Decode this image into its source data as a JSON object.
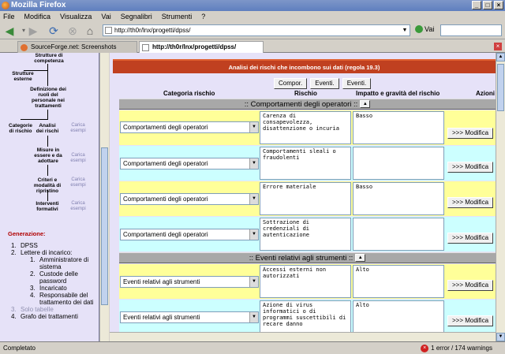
{
  "window": {
    "title": "Mozilla Firefox"
  },
  "menu": [
    "File",
    "Modifica",
    "Visualizza",
    "Vai",
    "Segnalibri",
    "Strumenti",
    "?"
  ],
  "nav": {
    "url": "http://th0r/lnx/progetti/dpss/",
    "go_label": "Vai"
  },
  "tabs": [
    {
      "label": "SourceForge.net: Screenshots"
    },
    {
      "label": "http://th0r/lnx/progetti/dpss/"
    }
  ],
  "sidebar": {
    "tree": {
      "strutture_competenza": "Strutture di competenza",
      "strutture_esterne": "Strutture esterne",
      "definizione": "Definizione dei ruoli del personale nei trattamenti",
      "categorie": "Categorie di rischio",
      "analisi": "Analisi dei rischi",
      "carica1": "Carica esempi",
      "misure": "Misure in essere e da adottare",
      "carica2": "Carica esempi",
      "criteri": "Criteri e modalità di ripristino",
      "carica3": "Carica esempi",
      "interventi": "Interventi formativi",
      "carica4": "Carica esempi"
    },
    "generation_title": "Generazione:",
    "list": [
      {
        "num": "1.",
        "label": "DPSS",
        "level": 1
      },
      {
        "num": "2.",
        "label": "Lettere di incarico:",
        "level": 1
      },
      {
        "num": "1.",
        "label": "Amministratore di sistema",
        "level": 2
      },
      {
        "num": "2.",
        "label": "Custode delle password",
        "level": 2
      },
      {
        "num": "3.",
        "label": "Incaricato",
        "level": 2
      },
      {
        "num": "4.",
        "label": "Responsabile del trattamento dei dati",
        "level": 2
      },
      {
        "num": "3.",
        "label": "Solo tabelle",
        "level": 1
      },
      {
        "num": "4.",
        "label": "Grafo dei trattamenti",
        "level": 1
      }
    ]
  },
  "main": {
    "header": "Analisi dei rischi che incombono sui dati (regola 19.3)",
    "buttons": [
      "Compor.",
      "Eventi.",
      "Eventi."
    ],
    "columns": [
      "Categoria rischio",
      "Rischio",
      "Impatto e gravità del rischio",
      "Azioni"
    ],
    "sections": [
      {
        "title": ":: Comportamenti degli operatori ::",
        "rows": [
          {
            "category": "Comportamenti degli operatori",
            "risk": "Carenza di consapevolezza, disattenzione o incuria",
            "impact": "Basso",
            "action": ">>> Modifica"
          },
          {
            "category": "Comportamenti degli operatori",
            "risk": "Comportamenti sleali o fraudolenti",
            "impact": "",
            "action": ">>> Modifica"
          },
          {
            "category": "Comportamenti degli operatori",
            "risk": "Errore materiale",
            "impact": "Basso",
            "action": ">>> Modifica"
          },
          {
            "category": "Comportamenti degli operatori",
            "risk": "Sottrazione di credenziali di autenticazione",
            "impact": "",
            "action": ">>> Modifica"
          }
        ]
      },
      {
        "title": ":: Eventi relativi agli strumenti ::",
        "rows": [
          {
            "category": "Eventi relativi agli strumenti",
            "risk": "Accessi esterni non autorizzati",
            "impact": "Alto",
            "action": ">>> Modifica"
          },
          {
            "category": "Eventi relativi agli strumenti",
            "risk": "Azione di virus informatici o di programmi suscettibili di recare danno",
            "impact": "Alto",
            "action": ">>> Modifica"
          }
        ]
      }
    ]
  },
  "status": {
    "text": "Completato",
    "errors": "1 error / 174 warnings"
  }
}
